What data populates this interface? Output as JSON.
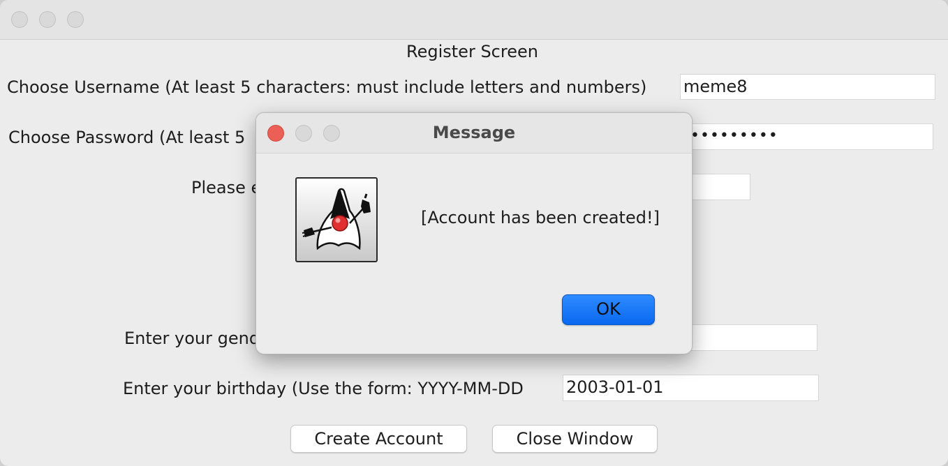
{
  "window": {
    "title": ""
  },
  "form": {
    "screen_title": "Register Screen",
    "username_label": "Choose Username (At least 5 characters: must include letters and numbers)",
    "username_value": "meme8",
    "password_label_visible": "Choose Password (At least 5",
    "password_masked": "•••••••••",
    "third_label_visible": "Please e",
    "gender_label_visible": "Enter your gend",
    "birthday_label": "Enter your birthday (Use the form: YYYY-MM-DD",
    "birthday_value": "2003-01-01",
    "create_button": "Create Account",
    "close_button": "Close Window"
  },
  "dialog": {
    "title": "Message",
    "message": "[Account has been created!]",
    "ok_label": "OK",
    "icon": "java-duke-icon"
  },
  "colors": {
    "accent": "#0a68f0",
    "close_red": "#ec5f57"
  }
}
